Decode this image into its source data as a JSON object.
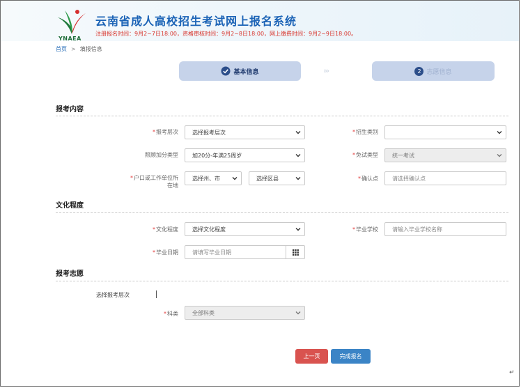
{
  "header": {
    "logo_text": "YNAEA",
    "title": "云南省成人高校招生考试网上报名系统",
    "notice": "注册报名时间：9月2~7日18:00，资格审核时间：9月2~8日18:00，网上缴费时间：9月2~9日18:00。"
  },
  "breadcrumb": {
    "home": "首页",
    "sep": ">",
    "current": "填报信息"
  },
  "steps": [
    {
      "label": "基本信息"
    },
    {
      "number": "2",
      "label": "志愿信息"
    }
  ],
  "step_arrows": "›››",
  "sections": {
    "content": "报考内容",
    "education": "文化程度",
    "wish": "报考志愿"
  },
  "required_mark": "*",
  "fields": {
    "level": {
      "label": "报考层次",
      "value": "选择报考层次"
    },
    "category": {
      "label": "招生类别",
      "value": ""
    },
    "bonus": {
      "label": "照顾加分类型",
      "value": "加20分-年满25周岁"
    },
    "exempt": {
      "label": "免试类型",
      "value": "统一考试"
    },
    "residence": {
      "label_line1": "户口或工作单位所",
      "label_line2": "在地",
      "city": "选择州、市",
      "county": "选择区县"
    },
    "confirm": {
      "label": "确认点",
      "placeholder": "请选择确认点"
    },
    "edu_level": {
      "label": "文化程度",
      "value": "选择文化程度"
    },
    "school": {
      "label": "毕业学校",
      "placeholder": "请输入毕业学校名称"
    },
    "grad_date": {
      "label": "毕业日期",
      "placeholder": "请填写毕业日期"
    },
    "wish_level": {
      "label": "选择报考层次"
    },
    "subject": {
      "label": "科类",
      "value": "全部科类"
    }
  },
  "buttons": {
    "prev": "上一页",
    "submit": "完成报名"
  },
  "para_mark": "↵",
  "colors": {
    "title_blue": "#1b63b6",
    "notice_red": "#d8342c",
    "step_bg": "#c6d3ea",
    "btn_red": "#d9534f",
    "btn_blue": "#3b84c6"
  }
}
